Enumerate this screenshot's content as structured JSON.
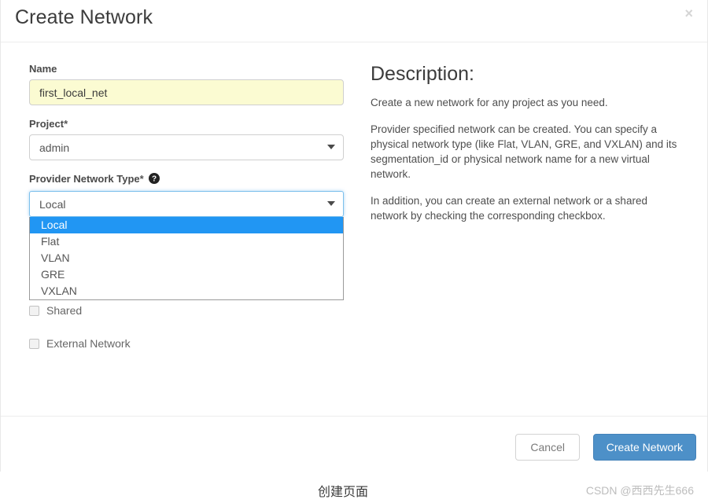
{
  "modal": {
    "title": "Create Network",
    "close_label": "×"
  },
  "form": {
    "name": {
      "label": "Name",
      "value": "first_local_net"
    },
    "project": {
      "label": "Project",
      "required_marker": "*",
      "value": "admin"
    },
    "provider_network_type": {
      "label": "Provider Network Type",
      "required_marker": "*",
      "help_icon": "question-circle-icon",
      "value": "Local",
      "expanded": true,
      "options": [
        {
          "label": "Local",
          "selected": true
        },
        {
          "label": "Flat",
          "selected": false
        },
        {
          "label": "VLAN",
          "selected": false
        },
        {
          "label": "GRE",
          "selected": false
        },
        {
          "label": "VXLAN",
          "selected": false
        }
      ]
    },
    "shared": {
      "label": "Shared",
      "checked": false
    },
    "external_network": {
      "label": "External Network",
      "checked": false
    }
  },
  "description": {
    "title": "Description:",
    "paragraphs": [
      "Create a new network for any project as you need.",
      "Provider specified network can be created. You can specify a physical network type (like Flat, VLAN, GRE, and VXLAN) and its segmentation_id or physical network name for a new virtual network.",
      "In addition, you can create an external network or a shared network by checking the corresponding checkbox."
    ]
  },
  "footer": {
    "cancel_label": "Cancel",
    "submit_label": "Create Network"
  },
  "page": {
    "caption": "创建页面",
    "watermark": "CSDN @西西先生666"
  },
  "colors": {
    "primary_button": "#4d90c8",
    "option_highlight": "#2196f3",
    "input_autofill": "#fbfbd2",
    "focus_border": "#7cc0ec"
  }
}
